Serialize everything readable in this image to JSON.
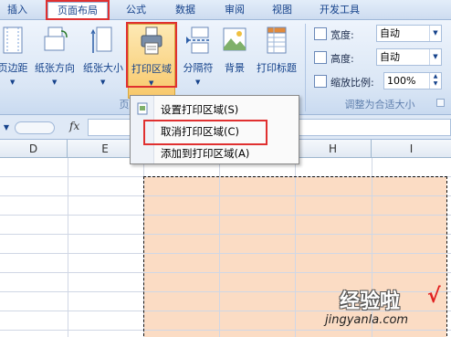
{
  "tabs": [
    {
      "label": "插入",
      "active": false
    },
    {
      "label": "页面布局",
      "active": true
    },
    {
      "label": "公式",
      "active": false
    },
    {
      "label": "数据",
      "active": false
    },
    {
      "label": "审阅",
      "active": false
    },
    {
      "label": "视图",
      "active": false
    },
    {
      "label": "开发工具",
      "active": false
    }
  ],
  "ribbon": {
    "page_setup": {
      "buttons": [
        {
          "label": "页边距",
          "icon": "margins-icon",
          "has_dropdown": true
        },
        {
          "label": "纸张方向",
          "icon": "orientation-icon",
          "has_dropdown": true
        },
        {
          "label": "纸张大小",
          "icon": "size-icon",
          "has_dropdown": true
        },
        {
          "label": "打印区域",
          "icon": "print-area-icon",
          "has_dropdown": true,
          "highlighted": true
        },
        {
          "label": "分隔符",
          "icon": "breaks-icon",
          "has_dropdown": true
        },
        {
          "label": "背景",
          "icon": "background-icon",
          "has_dropdown": false
        },
        {
          "label": "打印标题",
          "icon": "print-titles-icon",
          "has_dropdown": false
        }
      ],
      "group_label_fragment": "页"
    },
    "scale_to_fit": {
      "width_label": "宽度:",
      "width_value": "自动",
      "height_label": "高度:",
      "height_value": "自动",
      "scale_label": "缩放比例:",
      "scale_value": "100%",
      "group_label": "调整为合适大小"
    }
  },
  "formula_bar": {
    "fx_label": "fx",
    "value": ""
  },
  "columns": [
    "D",
    "E",
    "F",
    "G",
    "H",
    "I"
  ],
  "print_area_menu": {
    "items": [
      {
        "label": "设置打印区域(S)",
        "icon": "set-print-area-icon"
      },
      {
        "label": "取消打印区域(C)",
        "icon": "",
        "highlighted": true
      },
      {
        "label": "添加到打印区域(A)",
        "icon": ""
      }
    ]
  },
  "colors": {
    "highlight_box": "#e03030",
    "print_area_fill": "#fbdcc4",
    "ribbon_bg": "#dae6f5"
  },
  "watermark": {
    "title": "经验啦",
    "check": "√",
    "url": "jingyanla.com"
  }
}
